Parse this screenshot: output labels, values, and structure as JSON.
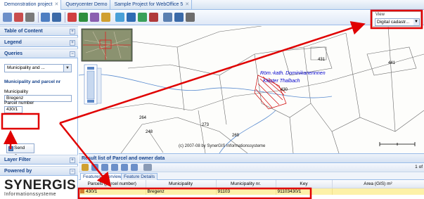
{
  "tabs": [
    {
      "label": "Demonstration project"
    },
    {
      "label": "Querycenter Demo"
    },
    {
      "label": "Sample Project for WebOffice 5"
    }
  ],
  "left_panel": {
    "table_of_content": "Table of Content",
    "legend": "Legend",
    "queries": "Queries",
    "query_select": "Municipality and ...",
    "query_title": "Municipality and parcel nr",
    "municipality_label": "Municipality",
    "municipality_value": "Bregenz",
    "parcel_label": "Parcel number",
    "parcel_value": "430/1",
    "send_query": "Send Query",
    "layer_filter": "Layer Filter",
    "powered_by": "Powered by",
    "logo_text": "SYNERGIS",
    "logo_sub": "Informationssysteme"
  },
  "map": {
    "copyright": "(c) 2007-08 by SynerGIS Informationssysteme",
    "label_church": "Röm.-kath. Dominikanerinnen",
    "label_church2": "Kloster Thalbach",
    "parcel_numbers": [
      "6",
      "2",
      "4",
      "2",
      "431",
      "441",
      "430",
      "27",
      "7",
      "5",
      "248",
      "269",
      "273",
      "4",
      "2",
      "4",
      "264",
      "46"
    ]
  },
  "view": {
    "label": "View",
    "value": "Digital cadastr..."
  },
  "results": {
    "title": "Result list of Parcel and owner data",
    "page_info": "1 of",
    "tab_overview": "Features Overview",
    "tab_details": "Feature Details",
    "columns": [
      "Parcels (parcel number)",
      "Municipality",
      "Municipality nr.",
      "Key",
      "Area (GIS) m²"
    ],
    "rows": [
      {
        "parcel": "430/1",
        "municipality": "Bregenz",
        "muni_nr": "91103",
        "key": "91103430/1",
        "area": ""
      }
    ]
  },
  "colors": {
    "accent": "#15428b",
    "highlight_row": "#fdf1a8",
    "annotation_red": "#e00000"
  }
}
